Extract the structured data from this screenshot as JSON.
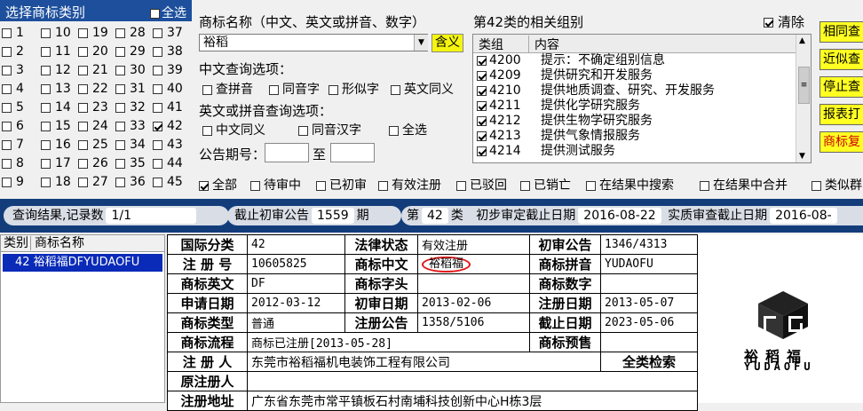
{
  "category_panel": {
    "title": "选择商标类别",
    "select_all": "全选",
    "columns": [
      [
        "1",
        "2",
        "3",
        "4",
        "5",
        "6",
        "7",
        "8",
        "9"
      ],
      [
        "10",
        "11",
        "12",
        "13",
        "14",
        "15",
        "16",
        "17",
        "18"
      ],
      [
        "19",
        "20",
        "21",
        "22",
        "23",
        "24",
        "25",
        "26",
        "27"
      ],
      [
        "28",
        "29",
        "30",
        "31",
        "32",
        "33",
        "34",
        "35",
        "36"
      ],
      [
        "37",
        "38",
        "39",
        "40",
        "41",
        "42",
        "43",
        "44",
        "45"
      ]
    ],
    "checked": [
      "42"
    ]
  },
  "query": {
    "trademark_label": "商标名称（中文、英文或拼音、数字）",
    "trademark_value": "裕稻",
    "meaning_button": "含义",
    "chinese_options_label": "中文查询选项：",
    "chinese_options": [
      "查拼音",
      "同音字",
      "形似字",
      "英文同义"
    ],
    "english_options_label": "英文或拼音查询选项：",
    "english_options": [
      "中文同义",
      "同音汉字",
      "全选"
    ],
    "announcement_label": "公告期号：",
    "to_label": "至"
  },
  "groups": {
    "title": "第42类的相关组别",
    "clear_label": "清除",
    "col_group": "类组",
    "col_content": "内容",
    "rows": [
      {
        "code": "4200",
        "text": "提示：不确定组别信息"
      },
      {
        "code": "4209",
        "text": "提供研究和开发服务"
      },
      {
        "code": "4210",
        "text": "提供地质调查、研究、开发服务"
      },
      {
        "code": "4211",
        "text": "提供化学研究服务"
      },
      {
        "code": "4212",
        "text": "提供生物学研究服务"
      },
      {
        "code": "4213",
        "text": "提供气象情报服务"
      },
      {
        "code": "4214",
        "text": "提供测试服务"
      }
    ]
  },
  "right_buttons": [
    "相同查",
    "近似查",
    "停止查",
    "报表打",
    "商标复"
  ],
  "filters": [
    "全部",
    "待审中",
    "已初审",
    "有效注册",
    "已驳回",
    "已销亡",
    "在结果中搜索",
    "在结果中合并",
    "类似群"
  ],
  "status_bar": {
    "result_label": "查询结果,记录数",
    "result_value": "1/1",
    "cutoff_label": "截止初审公告",
    "cutoff_value": "1559",
    "cutoff_unit": "期",
    "class_prefix": "第",
    "class_value": "42",
    "class_suffix": "类",
    "prelim_label": "初步审定截止日期",
    "prelim_value": "2016-08-22",
    "substantive_label": "实质审查截止日期",
    "substantive_value": "2016-08-"
  },
  "result_list": {
    "col_class": "类别",
    "col_name": "商标名称",
    "selected": "42 裕稻福DFYUDAOFU"
  },
  "detail": {
    "intl_class_label": "国际分类",
    "intl_class": "42",
    "legal_status_label": "法律状态",
    "legal_status": "有效注册",
    "prelim_pub_label": "初审公告",
    "prelim_pub": "1346/4313",
    "reg_no_label": "注 册 号",
    "reg_no": "10605825",
    "cn_name_label": "商标中文",
    "cn_name": "裕稻福",
    "pinyin_label": "商标拼音",
    "pinyin": "YUDAOFU",
    "en_name_label": "商标英文",
    "en_name": "DF",
    "letters_label": "商标字头",
    "letters": "",
    "digits_label": "商标数字",
    "digits": "",
    "apply_date_label": "申请日期",
    "apply_date": "2012-03-12",
    "prelim_date_label": "初审日期",
    "prelim_date": "2013-02-06",
    "reg_date_label": "注册日期",
    "reg_date": "2013-05-07",
    "type_label": "商标类型",
    "type": "普通",
    "reg_pub_label": "注册公告",
    "reg_pub": "1358/5106",
    "expiry_label": "截止日期",
    "expiry": "2023-05-06",
    "flow_label": "商标流程",
    "flow": "商标已注册[2013-05-28]",
    "warning_label": "商标预售",
    "registrant_label": "注 册 人",
    "registrant": "东莞市裕稻福机电装饰工程有限公司",
    "all_class_search": "全类检索",
    "orig_registrant_label": "原注册人",
    "orig_registrant": "",
    "address_label": "注册地址",
    "address": "广东省东莞市常平镇板石村南埔科技创新中心H栋3层"
  },
  "logo": {
    "cn": "裕稻福",
    "en": "YUDAOFU"
  }
}
